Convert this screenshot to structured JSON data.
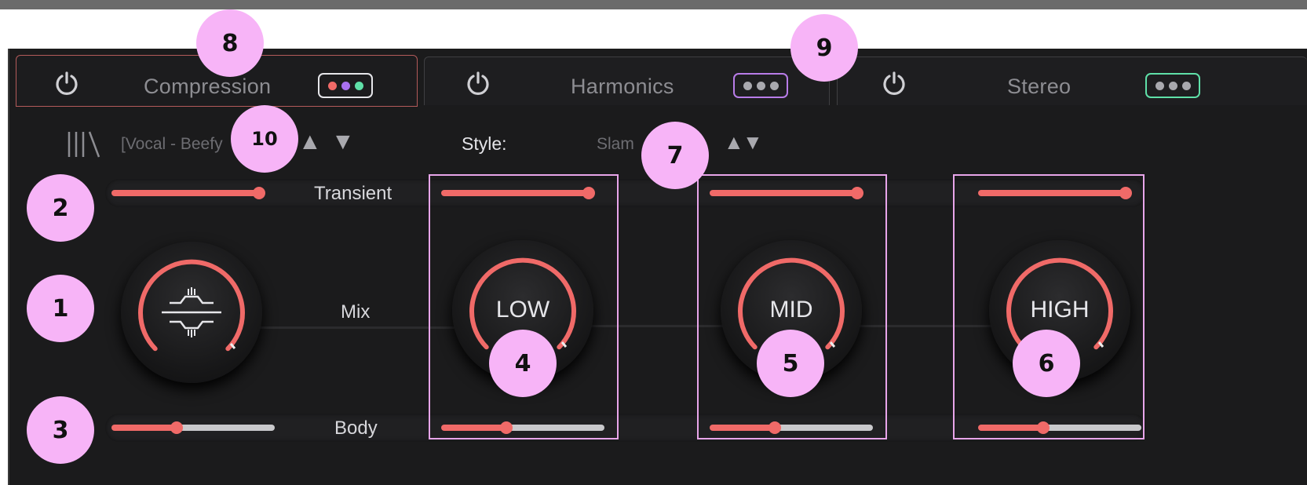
{
  "tabs": [
    {
      "label": "Compression",
      "active": true,
      "dot_colors": [
        "#f06a68",
        "#a970f0",
        "#5fe0a8"
      ],
      "border_color": "#e6e6ea"
    },
    {
      "label": "Harmonics",
      "active": false,
      "dot_colors": [
        "#a9a9ae",
        "#a9a9ae",
        "#a9a9ae"
      ],
      "border_color": "#b87ce8"
    },
    {
      "label": "Stereo",
      "active": false,
      "dot_colors": [
        "#a9a9ae",
        "#a9a9ae",
        "#a9a9ae"
      ],
      "border_color": "#5fe0a8"
    }
  ],
  "preset": {
    "name": "[Vocal - Beefy",
    "icon": "library-icon"
  },
  "style": {
    "label": "Style:",
    "value": "Slam"
  },
  "rows": {
    "transient_label": "Transient",
    "mix_label": "Mix",
    "body_label": "Body"
  },
  "bands": [
    {
      "knob_label": "",
      "icon": "compression-icon",
      "transient": 0.93,
      "body": 0.4
    },
    {
      "knob_label": "LOW",
      "transient": 0.93,
      "body": 0.4
    },
    {
      "knob_label": "MID",
      "transient": 0.93,
      "body": 0.4
    },
    {
      "knob_label": "HIGH",
      "transient": 0.93,
      "body": 0.4
    }
  ],
  "annotations": [
    "1",
    "2",
    "3",
    "4",
    "5",
    "6",
    "7",
    "8",
    "9",
    "10"
  ],
  "colors": {
    "accent": "#f06a68",
    "highlight": "#e8a5ea",
    "badge": "#f7b4f7"
  }
}
